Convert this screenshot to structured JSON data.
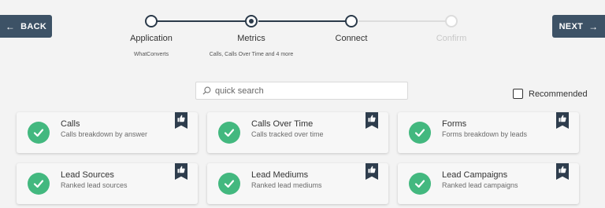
{
  "nav": {
    "back_label": "BACK",
    "next_label": "NEXT"
  },
  "steps": [
    {
      "label": "Application",
      "sub": "WhatConverts",
      "state": "done"
    },
    {
      "label": "Metrics",
      "sub": "Calls, Calls Over Time and 4 more",
      "state": "active"
    },
    {
      "label": "Connect",
      "sub": "",
      "state": "current"
    },
    {
      "label": "Confirm",
      "sub": "",
      "state": "pending"
    }
  ],
  "search": {
    "placeholder": "quick search",
    "value": ""
  },
  "recommended": {
    "label": "Recommended",
    "checked": false
  },
  "metrics": [
    {
      "title": "Calls",
      "subtitle": "Calls breakdown by answer"
    },
    {
      "title": "Calls Over Time",
      "subtitle": "Calls tracked over time"
    },
    {
      "title": "Forms",
      "subtitle": "Forms breakdown by leads"
    },
    {
      "title": "Lead Sources",
      "subtitle": "Ranked lead sources"
    },
    {
      "title": "Lead Mediums",
      "subtitle": "Ranked lead mediums"
    },
    {
      "title": "Lead Campaigns",
      "subtitle": "Ranked lead campaigns"
    }
  ],
  "colors": {
    "accent": "#3d5266",
    "check": "#43b87f",
    "ribbon": "#2e3d4d"
  }
}
